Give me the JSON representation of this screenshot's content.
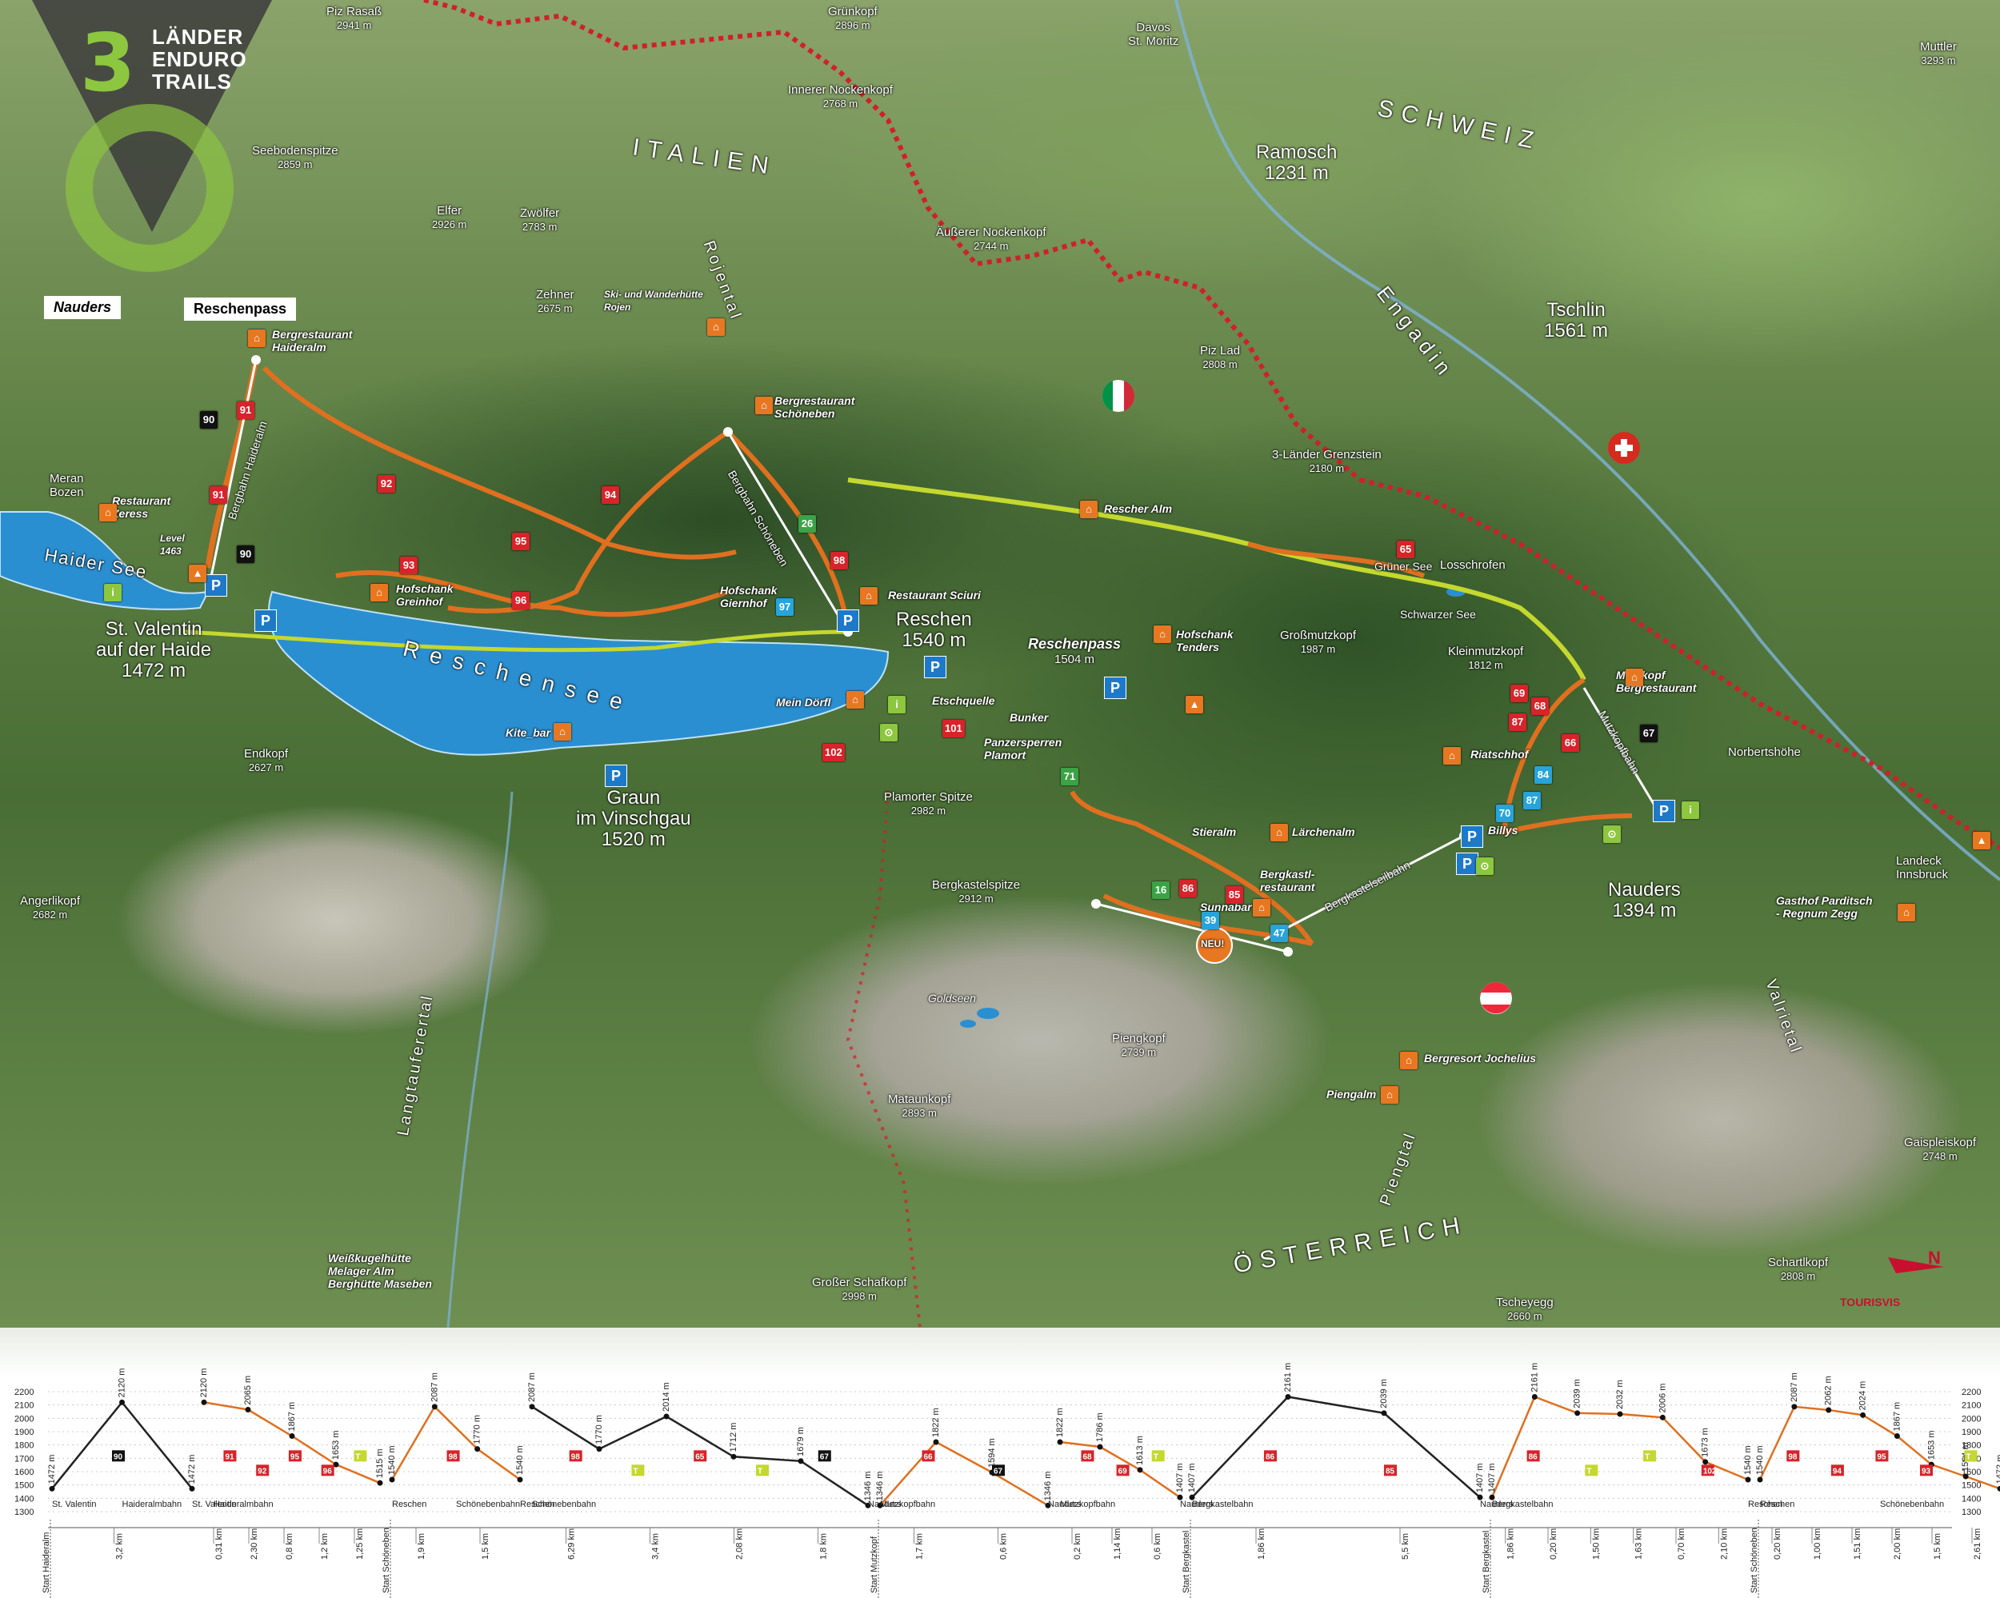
{
  "logo": {
    "numeral": "3",
    "line1": "LÄNDER",
    "line2": "ENDURO",
    "line3": "TRAILS",
    "tag_left": "Nauders",
    "tag_right": "Reschenpass"
  },
  "countries": {
    "italy": "ITALIEN",
    "switzerland": "SCHWEIZ",
    "austria": "ÖSTERREICH"
  },
  "valleys": {
    "rojental": "Rojental",
    "engadin": "Engadin",
    "langtaufer": "Langtauferertal",
    "pienztal": "Piengtal",
    "valrie": "Valrietal"
  },
  "towns": {
    "st_valentin": {
      "name": "St. Valentin",
      "sub": "auf der Haide",
      "alt": "1472 m"
    },
    "reschen": {
      "name": "Reschen",
      "alt": "1540 m"
    },
    "reschenpass": {
      "name": "Reschenpass",
      "alt": "1504 m"
    },
    "graun": {
      "name": "Graun",
      "sub": "im Vinschgau",
      "alt": "1520 m"
    },
    "nauders": {
      "name": "Nauders",
      "alt": "1394 m"
    },
    "ramosch": {
      "name": "Ramosch",
      "alt": "1231 m"
    },
    "tschlin": {
      "name": "Tschlin",
      "alt": "1561 m"
    }
  },
  "lakes": {
    "haider": "Haider See",
    "reschensee": "Reschensee",
    "gruner": "Grüner See",
    "schwarzer": "Schwarzer See",
    "goldseen": "Goldseen"
  },
  "peaks": {
    "piz_rasass": {
      "name": "Piz Rasaß",
      "alt": "2941 m"
    },
    "gruenkopf": {
      "name": "Grünkopf",
      "alt": "2896 m"
    },
    "innerer": {
      "name": "Innerer Nockenkopf",
      "alt": "2768 m"
    },
    "aeusserer": {
      "name": "Äußerer Nockenkopf",
      "alt": "2744 m"
    },
    "seeboden": {
      "name": "Seebodenspitze",
      "alt": "2859 m"
    },
    "elfer": {
      "name": "Elfer",
      "alt": "2926 m"
    },
    "zwoelfer": {
      "name": "Zwölfer",
      "alt": "2783 m"
    },
    "zehner": {
      "name": "Zehner",
      "alt": "2675 m"
    },
    "piz_lad": {
      "name": "Piz Lad",
      "alt": "2808 m"
    },
    "grenzstein": {
      "name": "3-Länder Grenzstein",
      "alt": "2180 m"
    },
    "mutler": {
      "name": "Muttler",
      "alt": "3293 m"
    },
    "grossmutz": {
      "name": "Großmutzkopf",
      "alt": "1987 m"
    },
    "kleinmutz": {
      "name": "Kleinmutzkopf",
      "alt": "1812 m"
    },
    "endkopf": {
      "name": "Endkopf",
      "alt": "2627 m"
    },
    "angerli": {
      "name": "Angerlikopf",
      "alt": "2682 m"
    },
    "plamorter": {
      "name": "Plamorter Spitze",
      "alt": "2982 m"
    },
    "bergkastel": {
      "name": "Bergkastelspitze",
      "alt": "2912 m"
    },
    "pieng": {
      "name": "Piengkopf",
      "alt": "2739 m"
    },
    "mataun": {
      "name": "Mataunkopf",
      "alt": "2893 m"
    },
    "schafkopf": {
      "name": "Großer Schafkopf",
      "alt": "2998 m"
    },
    "tscheyegg": {
      "name": "Tscheyegg",
      "alt": "2660 m"
    },
    "schartl": {
      "name": "Schartlkopf",
      "alt": "2808 m"
    },
    "gaisplei": {
      "name": "Gaispleiskopf",
      "alt": "2748 m"
    }
  },
  "places": {
    "davos": "Davos\nSt. Moritz",
    "meran": "Meran\nBozen",
    "landeck": "Landeck\nInnsbruck",
    "weisskugel": "Weißkugelhütte\nMelager Alm\nBerghütte Maseben",
    "haideralm": "Bergrestaurant\nHaideralm",
    "schoeneben": "Bergrestaurant\nSchöneben",
    "rojen": "Ski- und Wanderhütte\nRojen",
    "zeress": "Restaurant\nZeress",
    "level": "Level\n1463",
    "greinhof": "Hofschank\nGreinhof",
    "giernhof": "Hofschank\nGiernhof",
    "sciuri": "Restaurant Sciuri",
    "rescher_alm": "Rescher Alm",
    "tendres": "Hofschank\nTenders",
    "mein_doerfl": "Mein Dörfl",
    "kite_bar": "Kite_bar",
    "etschquelle": "Etschquelle",
    "bunker": "Bunker",
    "panzersperren": "Panzersperren\nPlamort",
    "stieralm": "Stieralm",
    "laerchenalm": "Lärchenalm",
    "sunnabar": "Sunnabar",
    "bergkastel_rest": "Bergkastl-\nrestaurant",
    "billys": "Billys",
    "losschrofen": "Losschrofen",
    "mutzkopf": "Mutzkopf\nBergrestaurant",
    "riatschhof": "Riatschhof",
    "norbertshoehe": "Norbertshöhe",
    "jochelius": "Bergresort Jochelius",
    "piengalm": "Piengalm",
    "parditsch": "Gasthof Parditsch\n- Regnum Zegg",
    "neu": "NEU!",
    "lifts": {
      "haiderbahn": "Bergbahn Haideralm",
      "schoenebenbahn": "Bergbahn Schöneben",
      "mutzkopfbahn": "Mutzkopfbahn",
      "bergkastelbahn": "Bergkastelseilbahn"
    }
  },
  "trails": [
    "90",
    "91",
    "91",
    "90",
    "92",
    "93",
    "94",
    "95",
    "96",
    "97",
    "98",
    "26",
    "65",
    "69",
    "68",
    "87",
    "66",
    "67",
    "84",
    "70",
    "87",
    "101",
    "102",
    "71",
    "16",
    "86",
    "85",
    "39",
    "47"
  ],
  "profiles": {
    "alt_axis": [
      "2200",
      "2100",
      "2000",
      "1900",
      "1800",
      "1700",
      "1600",
      "1500",
      "1400",
      "1300"
    ],
    "segments": [
      {
        "start": "Start Haideralm",
        "points": [
          "1472 m",
          "2120 m",
          "1472 m"
        ],
        "stations": [
          "St. Valentin",
          "Haideralmbahn",
          "St. Valentin"
        ],
        "dist": [
          "3,2 km"
        ],
        "trails": [
          "90"
        ]
      },
      {
        "start": "",
        "points": [
          "2120 m",
          "2065 m",
          "1867 m",
          "1653 m",
          "1515 m"
        ],
        "stations": [
          "Haideralmbahn"
        ],
        "dist": [
          "0,31 km",
          "2,30 km",
          "0,8 km",
          "1,2 km",
          "1,25 km"
        ],
        "trails": [
          "91",
          "92",
          "95",
          "96",
          "T"
        ]
      },
      {
        "start": "Start Schöneben",
        "points": [
          "1540 m",
          "2087 m",
          "1770 m",
          "1540 m"
        ],
        "stations": [
          "Reschen",
          "Schönebenbahn",
          "Reschen"
        ],
        "dist": [
          "1,9 km",
          "1,5 km"
        ],
        "trails": [
          "98"
        ]
      },
      {
        "start": "",
        "points": [
          "2087 m",
          "1770 m",
          "2014 m",
          "1712 m",
          "1679 m",
          "1346 m"
        ],
        "stations": [
          "Schönebenbahn",
          "Nauders"
        ],
        "dist": [
          "6,29 km",
          "3,4 km",
          "2,08 km",
          "1,8 km"
        ],
        "trails": [
          "98",
          "T",
          "65",
          "T",
          "67"
        ]
      },
      {
        "start": "Start Mutzkopf",
        "points": [
          "1346 m",
          "1822 m",
          "1594 m",
          "1346 m"
        ],
        "stations": [
          "Mutzkopfbahn",
          "Nauders"
        ],
        "dist": [
          "1,7 km",
          "0,6 km"
        ],
        "trails": [
          "66",
          "67"
        ]
      },
      {
        "start": "",
        "points": [
          "1822 m",
          "1786 m",
          "1613 m",
          "1407 m"
        ],
        "stations": [
          "Mutzkopfbahn",
          "Nauders"
        ],
        "dist": [
          "0,2 km",
          "1,14 km",
          "0,6 km"
        ],
        "trails": [
          "68",
          "69",
          "T"
        ]
      },
      {
        "start": "Start Bergkastel",
        "points": [
          "1407 m",
          "2161 m",
          "2039 m",
          "1407 m"
        ],
        "stations": [
          "Bergkastelbahn",
          "Nauders"
        ],
        "dist": [
          "1,86 km",
          "5,5 km"
        ],
        "trails": [
          "86",
          "85"
        ]
      },
      {
        "start": "Start Bergkastel",
        "points": [
          "1407 m",
          "2161 m",
          "2039 m",
          "2032 m",
          "2006 m",
          "1673 m",
          "1540 m"
        ],
        "stations": [
          "Bergkastelbahn",
          "Reschen"
        ],
        "dist": [
          "1,86 km",
          "0,20 km",
          "1,50 km",
          "1,63 km",
          "0,70 km",
          "2,10 km"
        ],
        "trails": [
          "86",
          "T",
          "T",
          "102"
        ]
      },
      {
        "start": "Start Schöneben",
        "points": [
          "1540 m",
          "2087 m",
          "2062 m",
          "2024 m",
          "1867 m",
          "1653 m",
          "1564 m",
          "1472 m"
        ],
        "stations": [
          "Reschen",
          "Schönebenbahn",
          "St. Valentin"
        ],
        "dist": [
          "0,20 km",
          "1,00 km",
          "1,51 km",
          "2,00 km",
          "1,5 km",
          "2,61 km"
        ],
        "trails": [
          "98",
          "94",
          "95",
          "93",
          "T"
        ]
      }
    ]
  },
  "brand": "TOURISVIS",
  "north": "N",
  "colors": {
    "trail_red": "#d8232a",
    "trail_orange": "#e0701f",
    "trail_lime": "#c4d82e",
    "border": "#d0202a",
    "lake": "#2a8fd1"
  }
}
